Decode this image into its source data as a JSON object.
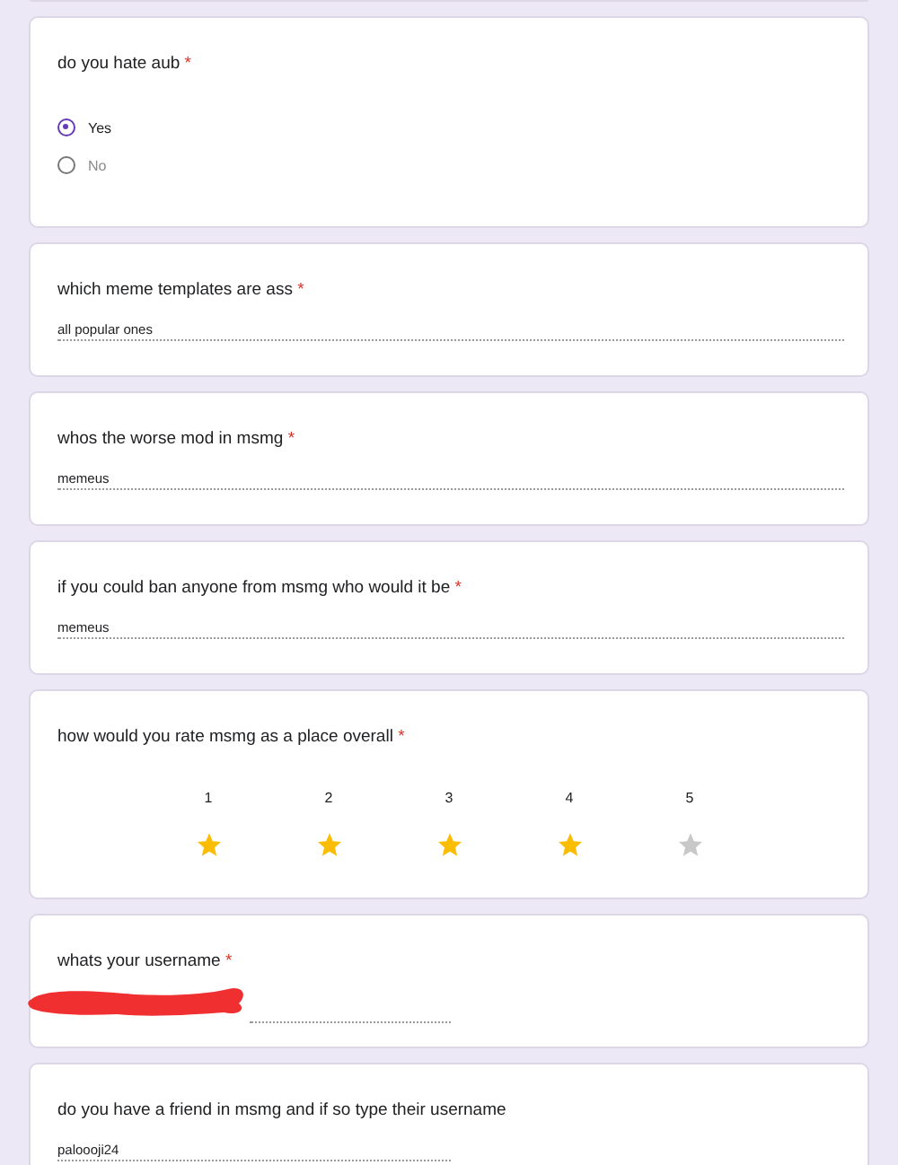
{
  "questions": [
    {
      "kind": "radio",
      "title": "do you hate aub",
      "required_mark": "*",
      "options": [
        {
          "label": "Yes",
          "selected": true
        },
        {
          "label": "No",
          "selected": false
        }
      ]
    },
    {
      "kind": "paragraph",
      "title": "which meme templates are ass",
      "required_mark": "*",
      "value": "all popular ones"
    },
    {
      "kind": "paragraph",
      "title": "whos the worse mod in msmg",
      "required_mark": "*",
      "value": "memeus"
    },
    {
      "kind": "paragraph",
      "title": "if you could ban anyone from msmg who would it be",
      "required_mark": "*",
      "value": "memeus"
    },
    {
      "kind": "rating",
      "title": "how would you rate msmg as a place overall",
      "required_mark": "*",
      "labels": [
        "1",
        "2",
        "3",
        "4",
        "5"
      ],
      "stars": 4
    },
    {
      "kind": "short",
      "title": "whats your username",
      "required_mark": "*",
      "redacted": true
    },
    {
      "kind": "short",
      "title": "do you have a friend in msmg and if so type their username",
      "value": "paloooji24"
    }
  ]
}
